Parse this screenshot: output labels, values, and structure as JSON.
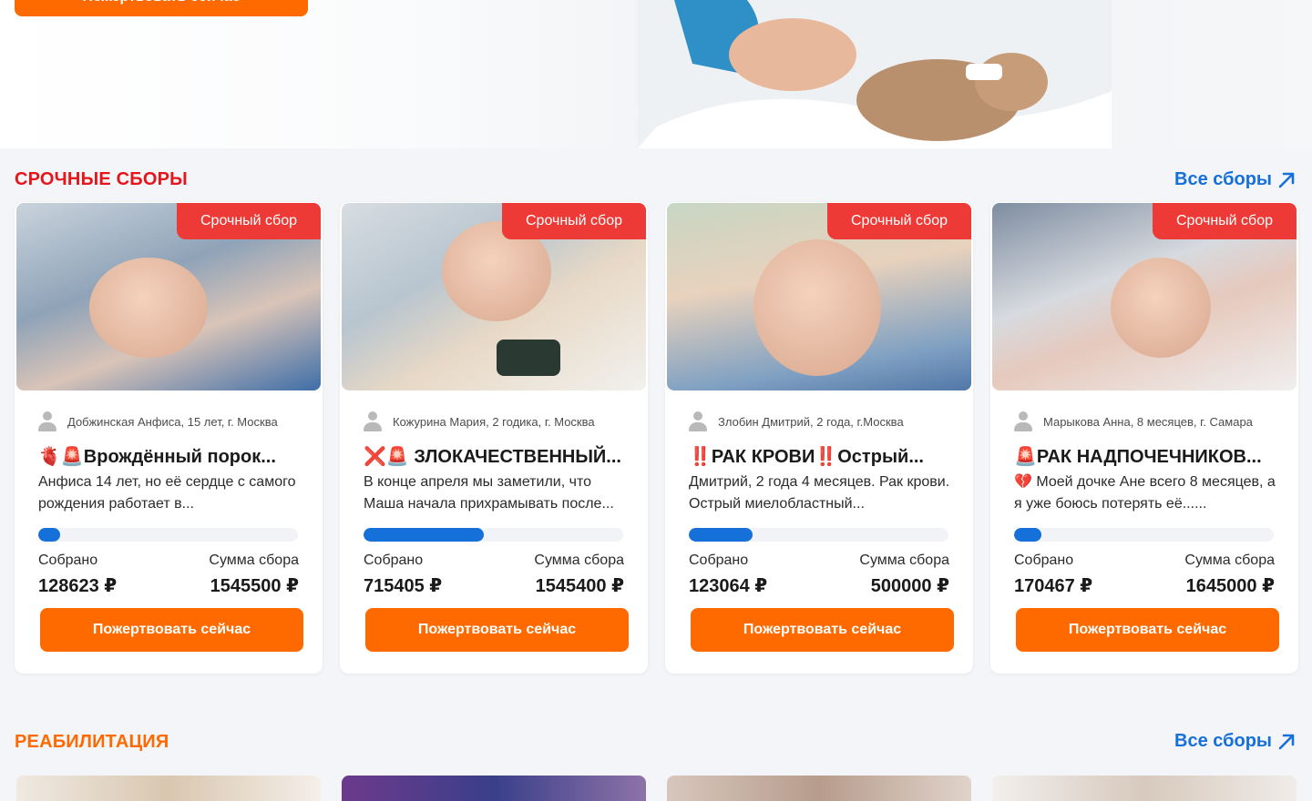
{
  "hero": {
    "donate_label": "Пожертвовать сейчас"
  },
  "sections": {
    "urgent": {
      "title": "СРОЧНЫЕ СБОРЫ",
      "all_link": "Все сборы"
    },
    "rehab": {
      "title": "РЕАБИЛИТАЦИЯ",
      "all_link": "Все сборы"
    }
  },
  "colors": {
    "accent": "#ff6a00",
    "urgent_title": "#e5161b",
    "link": "#1670d9",
    "badge": "#ee3a36",
    "progress": "#1670d9"
  },
  "cards": [
    {
      "badge": "Срочный сбор",
      "author": "Добжинская Анфиса, 15 лет, г. Москва",
      "title": "🫀🚨Врождённый порок...",
      "desc": "Анфиса 14 лет, но её сердце с самого рождения работает в...",
      "collected_label": "Собрано",
      "collected": "128623 ₽",
      "goal_label": "Сумма сбора",
      "goal": "1545500 ₽",
      "progress": 0.083,
      "button": "Пожертвовать сейчас"
    },
    {
      "badge": "Срочный сбор",
      "author": "Кожурина Мария, 2 годика, г. Москва",
      "title": "❌🚨 ЗЛОКАЧЕСТВЕННЫЙ...",
      "desc": "В конце апреля мы заметили, что Маша начала прихрамывать после...",
      "collected_label": "Собрано",
      "collected": "715405 ₽",
      "goal_label": "Сумма сбора",
      "goal": "1545400 ₽",
      "progress": 0.463,
      "button": "Пожертвовать сейчас"
    },
    {
      "badge": "Срочный сбор",
      "author": "Злобин Дмитрий, 2 года, г.Москва",
      "title": "‼️РАК КРОВИ‼️Острый...",
      "desc": "Дмитрий, 2 года 4 месяцев. Рак крови. Острый миелобластный...",
      "collected_label": "Собрано",
      "collected": "123064 ₽",
      "goal_label": "Сумма сбора",
      "goal": "500000 ₽",
      "progress": 0.246,
      "button": "Пожертвовать сейчас"
    },
    {
      "badge": "Срочный сбор",
      "author": "Марыкова Анна, 8 месяцев, г. Самара",
      "title": "🚨РАК НАДПОЧЕЧНИКОВ...",
      "desc": "💔 Моей дочке Ане всего 8 месяцев, а я уже боюсь потерять её......",
      "collected_label": "Собрано",
      "collected": "170467 ₽",
      "goal_label": "Сумма сбора",
      "goal": "1645000 ₽",
      "progress": 0.104,
      "button": "Пожертвовать сейчас"
    }
  ]
}
